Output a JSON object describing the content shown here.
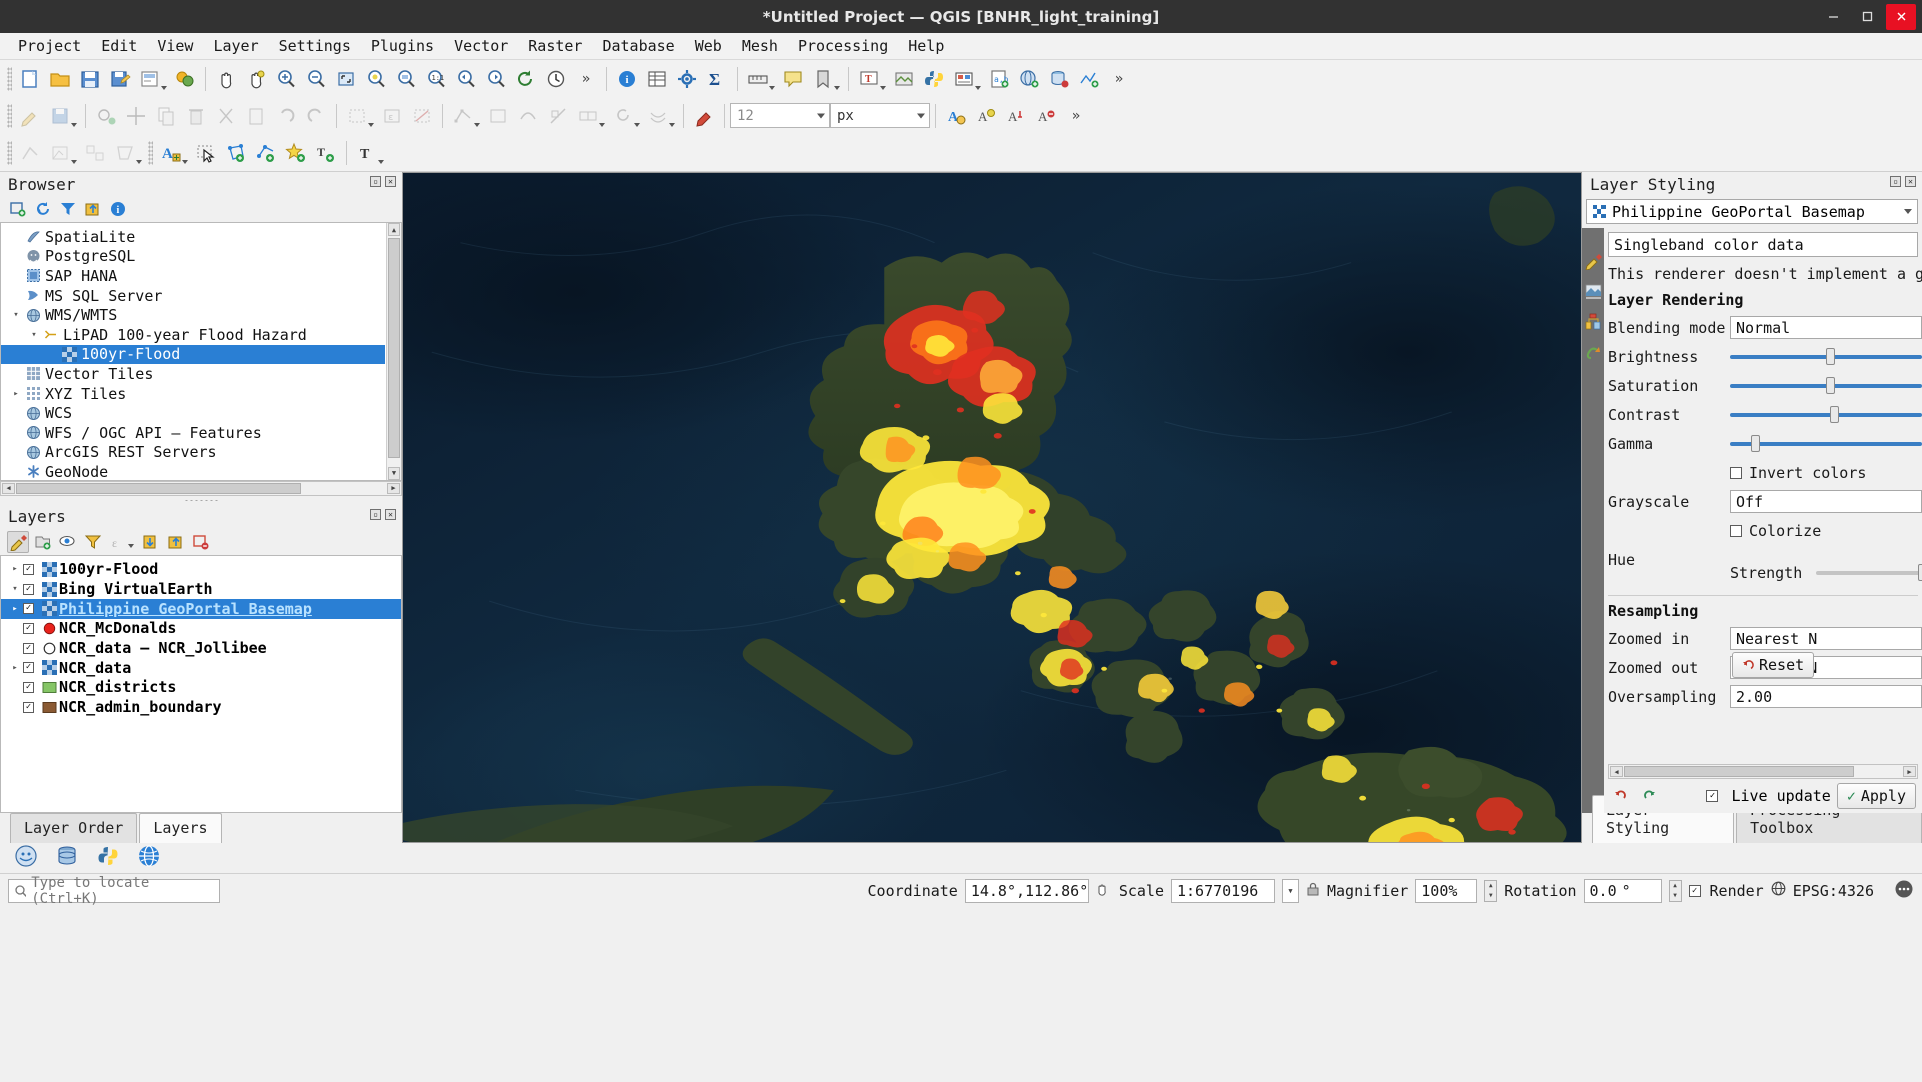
{
  "window": {
    "title": "*Untitled Project — QGIS [BNHR_light_training]",
    "minimize": "—",
    "maximize": "▢",
    "close": "✕"
  },
  "menubar": [
    {
      "label": "Project"
    },
    {
      "label": "Edit"
    },
    {
      "label": "View"
    },
    {
      "label": "Layer"
    },
    {
      "label": "Settings"
    },
    {
      "label": "Plugins"
    },
    {
      "label": "Vector"
    },
    {
      "label": "Raster"
    },
    {
      "label": "Database"
    },
    {
      "label": "Web"
    },
    {
      "label": "Mesh"
    },
    {
      "label": "Processing"
    },
    {
      "label": "Help"
    }
  ],
  "toolbar": {
    "font_size": "12",
    "font_unit": "px",
    "overflow": "»"
  },
  "browser": {
    "title": "Browser",
    "float_btn": "▫",
    "close_btn": "✕",
    "toolbar": [
      "add-layer-icon",
      "refresh-icon",
      "filter-icon",
      "collapse-all-icon",
      "properties-icon"
    ],
    "items": [
      {
        "label": "SpatiaLite",
        "icon": "spatialite-icon",
        "indent": 0,
        "expander": "",
        "selected": false
      },
      {
        "label": "PostgreSQL",
        "icon": "postgres-icon",
        "indent": 0,
        "expander": "",
        "selected": false
      },
      {
        "label": "SAP HANA",
        "icon": "hana-icon",
        "indent": 0,
        "expander": "",
        "selected": false
      },
      {
        "label": "MS SQL Server",
        "icon": "mssql-icon",
        "indent": 0,
        "expander": "",
        "selected": false
      },
      {
        "label": "WMS/WMTS",
        "icon": "globe-icon",
        "indent": 0,
        "expander": "▾",
        "selected": false
      },
      {
        "label": "LiPAD 100-year Flood Hazard",
        "icon": "connection-icon",
        "indent": 1,
        "expander": "▾",
        "selected": false
      },
      {
        "label": "100yr-Flood",
        "icon": "raster-icon",
        "indent": 2,
        "expander": "",
        "selected": true
      },
      {
        "label": "Vector Tiles",
        "icon": "grid-icon",
        "indent": 0,
        "expander": "",
        "selected": false
      },
      {
        "label": "XYZ Tiles",
        "icon": "dotgrid-icon",
        "indent": 0,
        "expander": "▸",
        "selected": false
      },
      {
        "label": "WCS",
        "icon": "globe-icon",
        "indent": 0,
        "expander": "",
        "selected": false
      },
      {
        "label": "WFS / OGC API – Features",
        "icon": "globe-icon",
        "indent": 0,
        "expander": "",
        "selected": false
      },
      {
        "label": "ArcGIS REST Servers",
        "icon": "globe-icon",
        "indent": 0,
        "expander": "",
        "selected": false
      },
      {
        "label": "GeoNode",
        "icon": "asterisk-icon",
        "indent": 0,
        "expander": "",
        "selected": false
      }
    ]
  },
  "layers": {
    "title": "Layers",
    "float_btn": "▫",
    "close_btn": "✕",
    "toolbar": [
      "style-manager-icon",
      "add-group-icon",
      "visibility-icon",
      "filter-legend-icon",
      "expression-filter-icon",
      "expand-all-icon",
      "collapse-all-icon",
      "remove-layer-icon"
    ],
    "items": [
      {
        "label": "100yr-Flood",
        "expander": "▸",
        "checked": true,
        "symbol": "raster",
        "selected": false
      },
      {
        "label": "Bing VirtualEarth",
        "expander": "▾",
        "checked": true,
        "symbol": "raster",
        "selected": false
      },
      {
        "label": "Philippine GeoPortal Basemap",
        "expander": "▸",
        "checked": true,
        "symbol": "raster",
        "selected": true
      },
      {
        "label": "NCR_McDonalds",
        "expander": "",
        "checked": true,
        "symbol": "point-red",
        "selected": false
      },
      {
        "label": "NCR_data — NCR_Jollibee",
        "expander": "",
        "checked": true,
        "symbol": "point-hollow",
        "selected": false
      },
      {
        "label": "NCR_data",
        "expander": "▸",
        "checked": true,
        "symbol": "raster",
        "selected": false
      },
      {
        "label": "NCR_districts",
        "expander": "",
        "checked": true,
        "symbol": "polygon-green",
        "selected": false
      },
      {
        "label": "NCR_admin_boundary",
        "expander": "",
        "checked": true,
        "symbol": "polygon-brown",
        "selected": false
      }
    ],
    "tabs": [
      {
        "label": "Layer Order",
        "active": false
      },
      {
        "label": "Layers",
        "active": true
      }
    ]
  },
  "layer_styling": {
    "title": "Layer Styling",
    "float_btn": "▫",
    "close_btn": "✕",
    "layer_selector": "Philippine GeoPortal Basemap",
    "renderer": "Singleband color data",
    "renderer_note": "This renderer doesn't implement a gra",
    "section_rendering": "Layer Rendering",
    "blending_label": "Blending mode",
    "blending_value": "Normal",
    "brightness_label": "Brightness",
    "brightness_value": 0,
    "saturation_label": "Saturation",
    "saturation_value": 0,
    "contrast_label": "Contrast",
    "contrast_value": 0,
    "gamma_label": "Gamma",
    "gamma_value": 1.0,
    "invert_colors_label": "Invert colors",
    "invert_colors_checked": false,
    "grayscale_label": "Grayscale",
    "grayscale_value": "Off",
    "hue_label": "Hue",
    "colorize_label": "Colorize",
    "colorize_checked": false,
    "strength_label": "Strength",
    "reset_label": "Reset",
    "section_resampling": "Resampling",
    "zoomed_in_label": "Zoomed in",
    "zoomed_in_value": "Nearest N",
    "zoomed_out_label": "Zoomed out",
    "zoomed_out_value": "Nearest N",
    "oversampling_label": "Oversampling",
    "oversampling_value": "2.00",
    "live_update_label": "Live update",
    "live_update_checked": true,
    "apply_label": "Apply",
    "tabs": [
      {
        "label": "Layer Styling",
        "active": true
      },
      {
        "label": "Processing Toolbox",
        "active": false
      }
    ]
  },
  "statusbar": {
    "search_placeholder": "Type to locate (Ctrl+K)",
    "coordinate_label": "Coordinate",
    "coordinate_value": "14.8°,112.86°",
    "scale_label": "Scale",
    "scale_value": "1:6770196",
    "magnifier_label": "Magnifier",
    "magnifier_value": "100%",
    "rotation_label": "Rotation",
    "rotation_value": "0.0",
    "rotation_unit": "°",
    "render_label": "Render",
    "render_checked": true,
    "crs_label": "EPSG:4326",
    "messages_icon": "messages-icon"
  },
  "bottombar": {
    "icons": [
      "python-console-icon",
      "database-icon",
      "python-icon",
      "globe-icon"
    ]
  },
  "colors": {
    "selection_blue": "#2a7fd4",
    "selected_text": "#b8e2ff",
    "titlebar": "#323232",
    "close_red": "#e81123",
    "slider_blue": "#3a7ec4",
    "map_ocean": "#0e2338",
    "flood_red": "#e03020",
    "flood_yellow": "#ffe83a",
    "flood_orange": "#ff9020"
  },
  "map": {
    "description": "Philippines satellite basemap with 100-year flood hazard overlay"
  }
}
